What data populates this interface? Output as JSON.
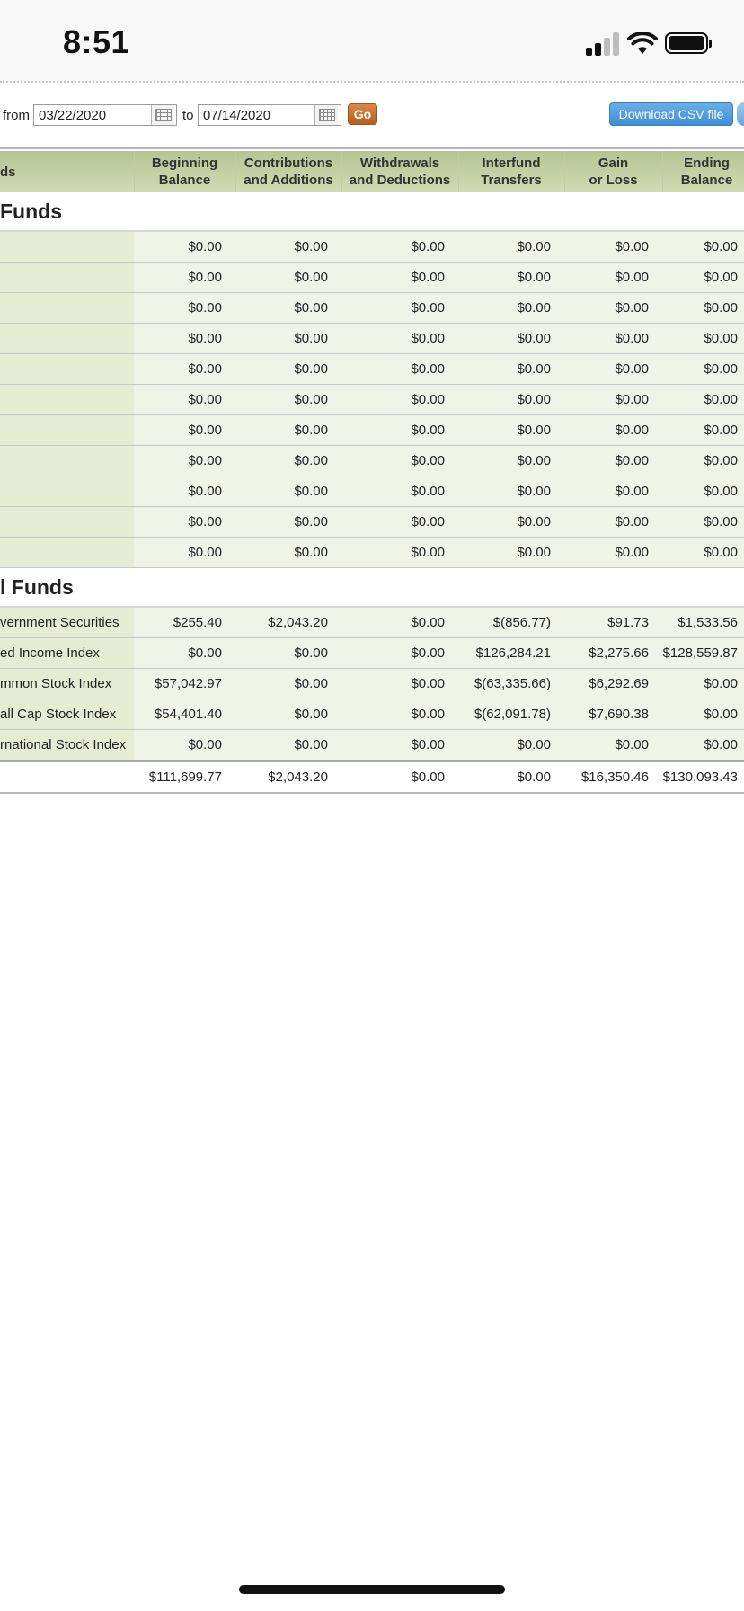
{
  "status_bar": {
    "time": "8:51"
  },
  "filter": {
    "from_label": "from",
    "from_value": "03/22/2020",
    "to_label": "to",
    "to_value": "07/14/2020",
    "go_label": "Go",
    "download_label": "Download CSV file"
  },
  "table": {
    "headers": {
      "funds": "ds",
      "beginning_line1": "Beginning",
      "beginning_line2": "Balance",
      "contrib_line1": "Contributions",
      "contrib_line2": "and Additions",
      "withdraw_line1": "Withdrawals",
      "withdraw_line2": "and Deductions",
      "interfund_line1": "Interfund",
      "interfund_line2": "Transfers",
      "gain_line1": "Gain",
      "gain_line2": "or Loss",
      "ending_line1": "Ending",
      "ending_line2": "Balance"
    },
    "section1": {
      "title": "Funds"
    },
    "section1_rows": [
      {
        "name": "",
        "beginning": "$0.00",
        "contributions": "$0.00",
        "withdrawals": "$0.00",
        "interfund": "$0.00",
        "gain": "$0.00",
        "ending": "$0.00"
      },
      {
        "name": "",
        "beginning": "$0.00",
        "contributions": "$0.00",
        "withdrawals": "$0.00",
        "interfund": "$0.00",
        "gain": "$0.00",
        "ending": "$0.00"
      },
      {
        "name": "",
        "beginning": "$0.00",
        "contributions": "$0.00",
        "withdrawals": "$0.00",
        "interfund": "$0.00",
        "gain": "$0.00",
        "ending": "$0.00"
      },
      {
        "name": "",
        "beginning": "$0.00",
        "contributions": "$0.00",
        "withdrawals": "$0.00",
        "interfund": "$0.00",
        "gain": "$0.00",
        "ending": "$0.00"
      },
      {
        "name": "",
        "beginning": "$0.00",
        "contributions": "$0.00",
        "withdrawals": "$0.00",
        "interfund": "$0.00",
        "gain": "$0.00",
        "ending": "$0.00"
      },
      {
        "name": "",
        "beginning": "$0.00",
        "contributions": "$0.00",
        "withdrawals": "$0.00",
        "interfund": "$0.00",
        "gain": "$0.00",
        "ending": "$0.00"
      },
      {
        "name": "",
        "beginning": "$0.00",
        "contributions": "$0.00",
        "withdrawals": "$0.00",
        "interfund": "$0.00",
        "gain": "$0.00",
        "ending": "$0.00"
      },
      {
        "name": "",
        "beginning": "$0.00",
        "contributions": "$0.00",
        "withdrawals": "$0.00",
        "interfund": "$0.00",
        "gain": "$0.00",
        "ending": "$0.00"
      },
      {
        "name": "",
        "beginning": "$0.00",
        "contributions": "$0.00",
        "withdrawals": "$0.00",
        "interfund": "$0.00",
        "gain": "$0.00",
        "ending": "$0.00"
      },
      {
        "name": "",
        "beginning": "$0.00",
        "contributions": "$0.00",
        "withdrawals": "$0.00",
        "interfund": "$0.00",
        "gain": "$0.00",
        "ending": "$0.00"
      },
      {
        "name": "",
        "beginning": "$0.00",
        "contributions": "$0.00",
        "withdrawals": "$0.00",
        "interfund": "$0.00",
        "gain": "$0.00",
        "ending": "$0.00"
      }
    ],
    "section2": {
      "title": "l Funds"
    },
    "section2_rows": [
      {
        "name": "vernment Securities",
        "beginning": "$255.40",
        "contributions": "$2,043.20",
        "withdrawals": "$0.00",
        "interfund": "$(856.77)",
        "gain": "$91.73",
        "ending": "$1,533.56"
      },
      {
        "name": "ed Income Index",
        "beginning": "$0.00",
        "contributions": "$0.00",
        "withdrawals": "$0.00",
        "interfund": "$126,284.21",
        "gain": "$2,275.66",
        "ending": "$128,559.87"
      },
      {
        "name": "mmon Stock Index",
        "beginning": "$57,042.97",
        "contributions": "$0.00",
        "withdrawals": "$0.00",
        "interfund": "$(63,335.66)",
        "gain": "$6,292.69",
        "ending": "$0.00"
      },
      {
        "name": "all Cap Stock Index",
        "beginning": "$54,401.40",
        "contributions": "$0.00",
        "withdrawals": "$0.00",
        "interfund": "$(62,091.78)",
        "gain": "$7,690.38",
        "ending": "$0.00"
      },
      {
        "name": "rnational Stock Index",
        "beginning": "$0.00",
        "contributions": "$0.00",
        "withdrawals": "$0.00",
        "interfund": "$0.00",
        "gain": "$0.00",
        "ending": "$0.00"
      }
    ],
    "total": {
      "beginning": "$111,699.77",
      "contributions": "$2,043.20",
      "withdrawals": "$0.00",
      "interfund": "$0.00",
      "gain": "$16,350.46",
      "ending": "$130,093.43"
    }
  }
}
